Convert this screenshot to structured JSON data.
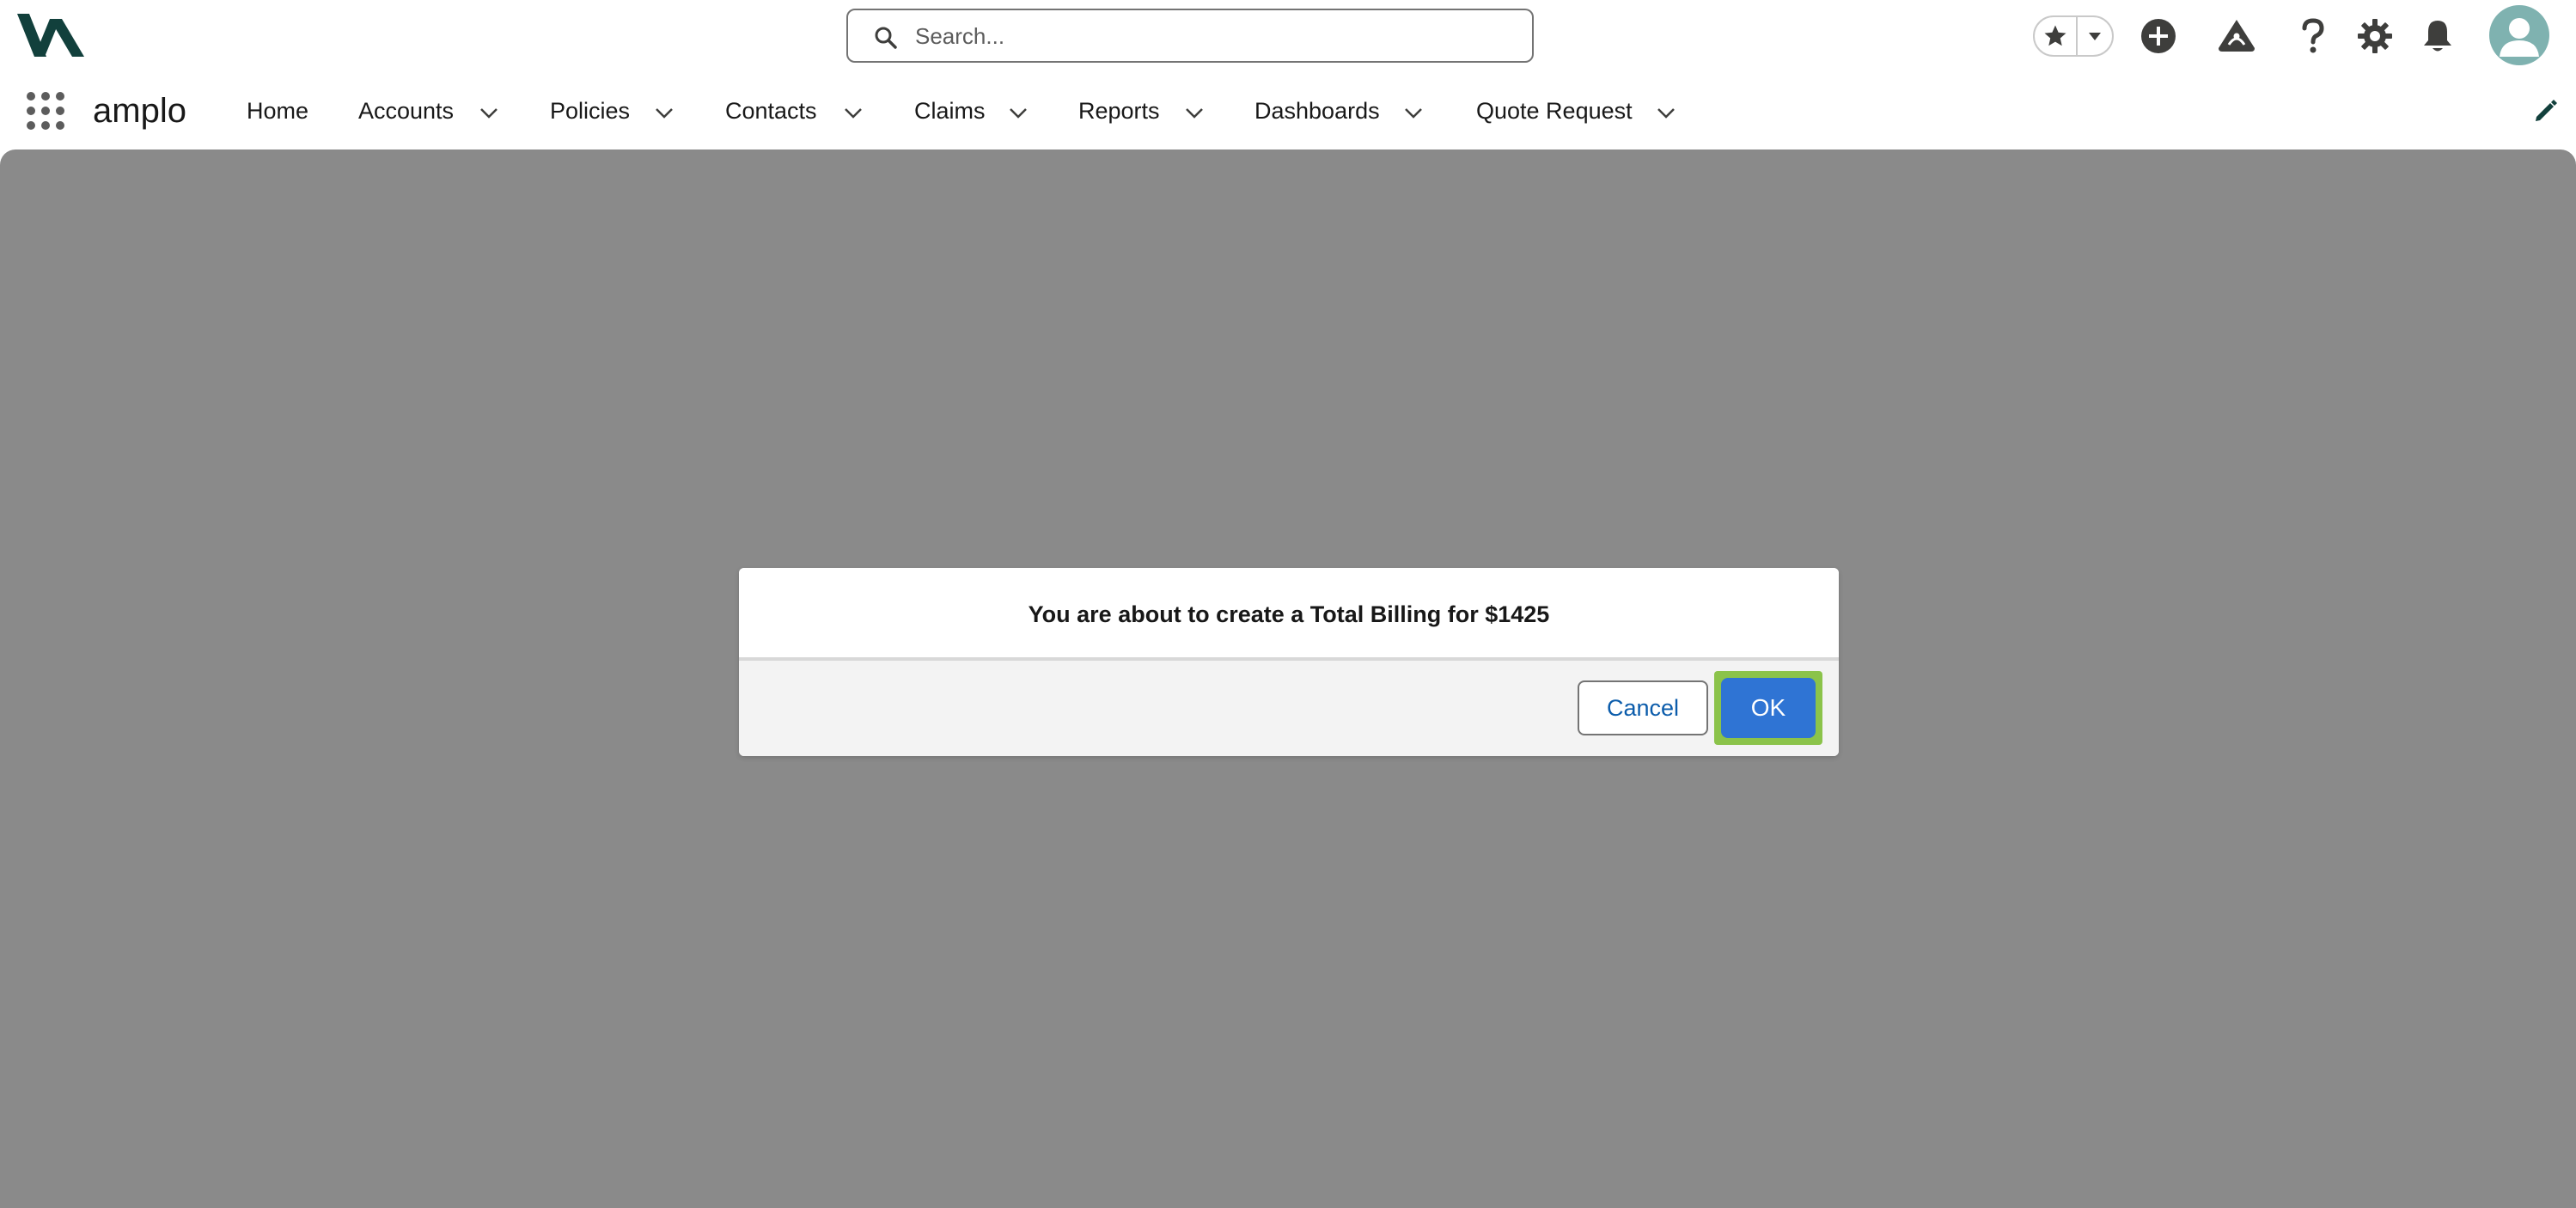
{
  "header": {
    "search": {
      "placeholder": "Search..."
    },
    "icons": [
      "favorite-star-icon",
      "favorites-dropdown-icon",
      "add-icon",
      "trailhead-icon",
      "help-icon",
      "settings-icon",
      "notifications-bell-icon",
      "avatar-icon"
    ]
  },
  "nav": {
    "app_name": "amplo",
    "items": [
      {
        "label": "Home",
        "has_menu": false
      },
      {
        "label": "Accounts",
        "has_menu": true
      },
      {
        "label": "Policies",
        "has_menu": true
      },
      {
        "label": "Contacts",
        "has_menu": true
      },
      {
        "label": "Claims",
        "has_menu": true
      },
      {
        "label": "Reports",
        "has_menu": true
      },
      {
        "label": "Dashboards",
        "has_menu": true
      },
      {
        "label": "Quote Request",
        "has_menu": true
      }
    ]
  },
  "modal": {
    "message": "You are about to create a Total Billing for $1425",
    "cancel_label": "Cancel",
    "ok_label": "OK"
  },
  "colors": {
    "brand": "#12403c",
    "overlay": "#8a8a8a",
    "ok_button": "#2f74d4",
    "focus_ring": "#8bc34a",
    "link_blue": "#0b5cab",
    "avatar": "#7fb2b0"
  }
}
